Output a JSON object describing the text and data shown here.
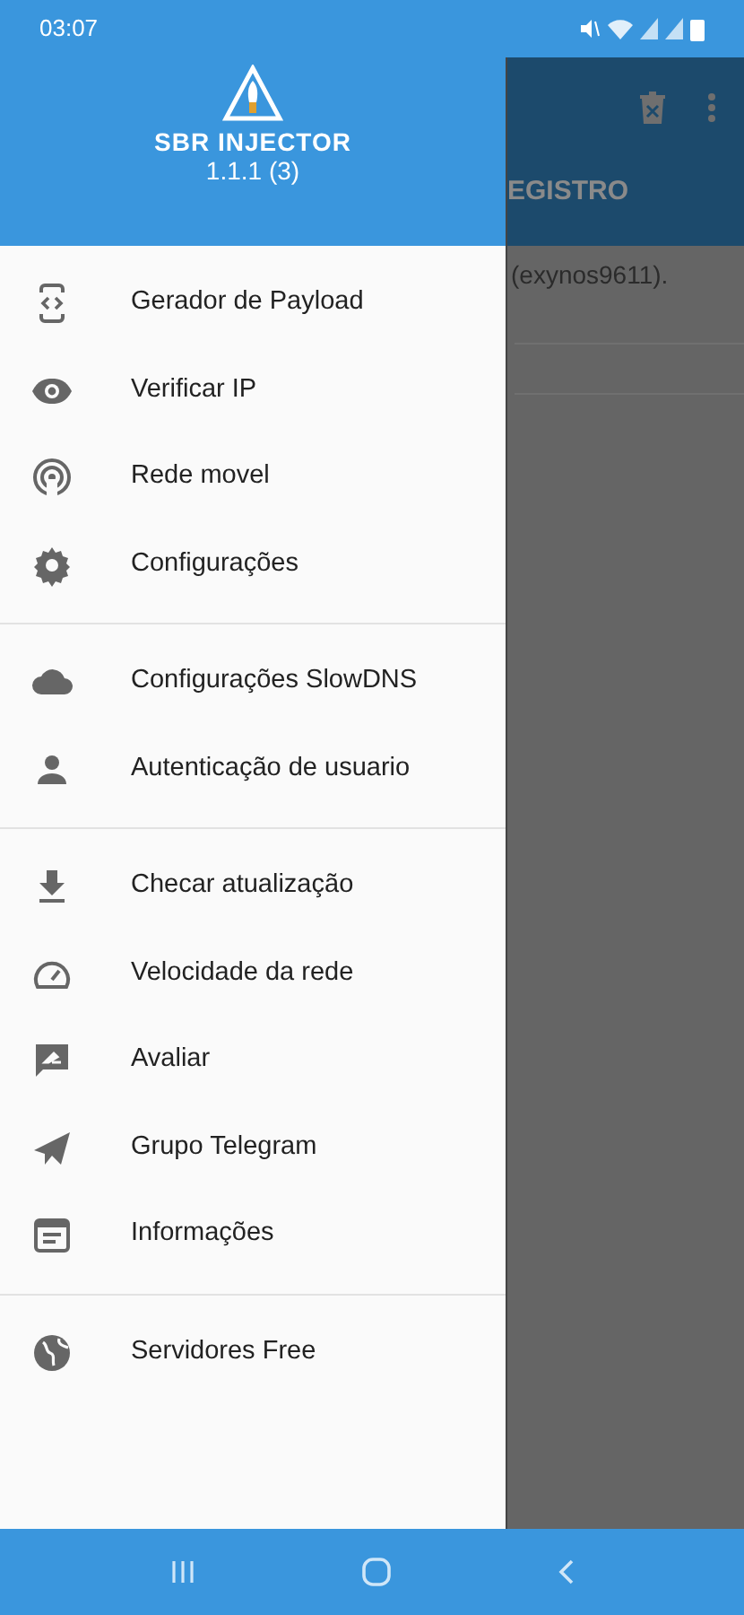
{
  "status_bar": {
    "time": "03:07"
  },
  "drawer": {
    "header": {
      "title": "SBR INJECTOR",
      "version": "1.1.1 (3)"
    },
    "groups": [
      {
        "items": [
          {
            "label": "Gerador de Payload"
          },
          {
            "label": "Verificar IP"
          },
          {
            "label": "Rede movel"
          },
          {
            "label": "Configurações"
          }
        ]
      },
      {
        "items": [
          {
            "label": "Configurações SlowDNS"
          },
          {
            "label": "Autenticação de usuario"
          }
        ]
      },
      {
        "items": [
          {
            "label": "Checar atualização"
          },
          {
            "label": "Velocidade da rede"
          },
          {
            "label": "Avaliar"
          },
          {
            "label": "Grupo Telegram"
          },
          {
            "label": "Informações"
          }
        ]
      },
      {
        "items": [
          {
            "label": "Servidores Free"
          }
        ]
      }
    ]
  },
  "background": {
    "tab_label": "EGISTRO",
    "log_line": "(exynos9611)."
  }
}
